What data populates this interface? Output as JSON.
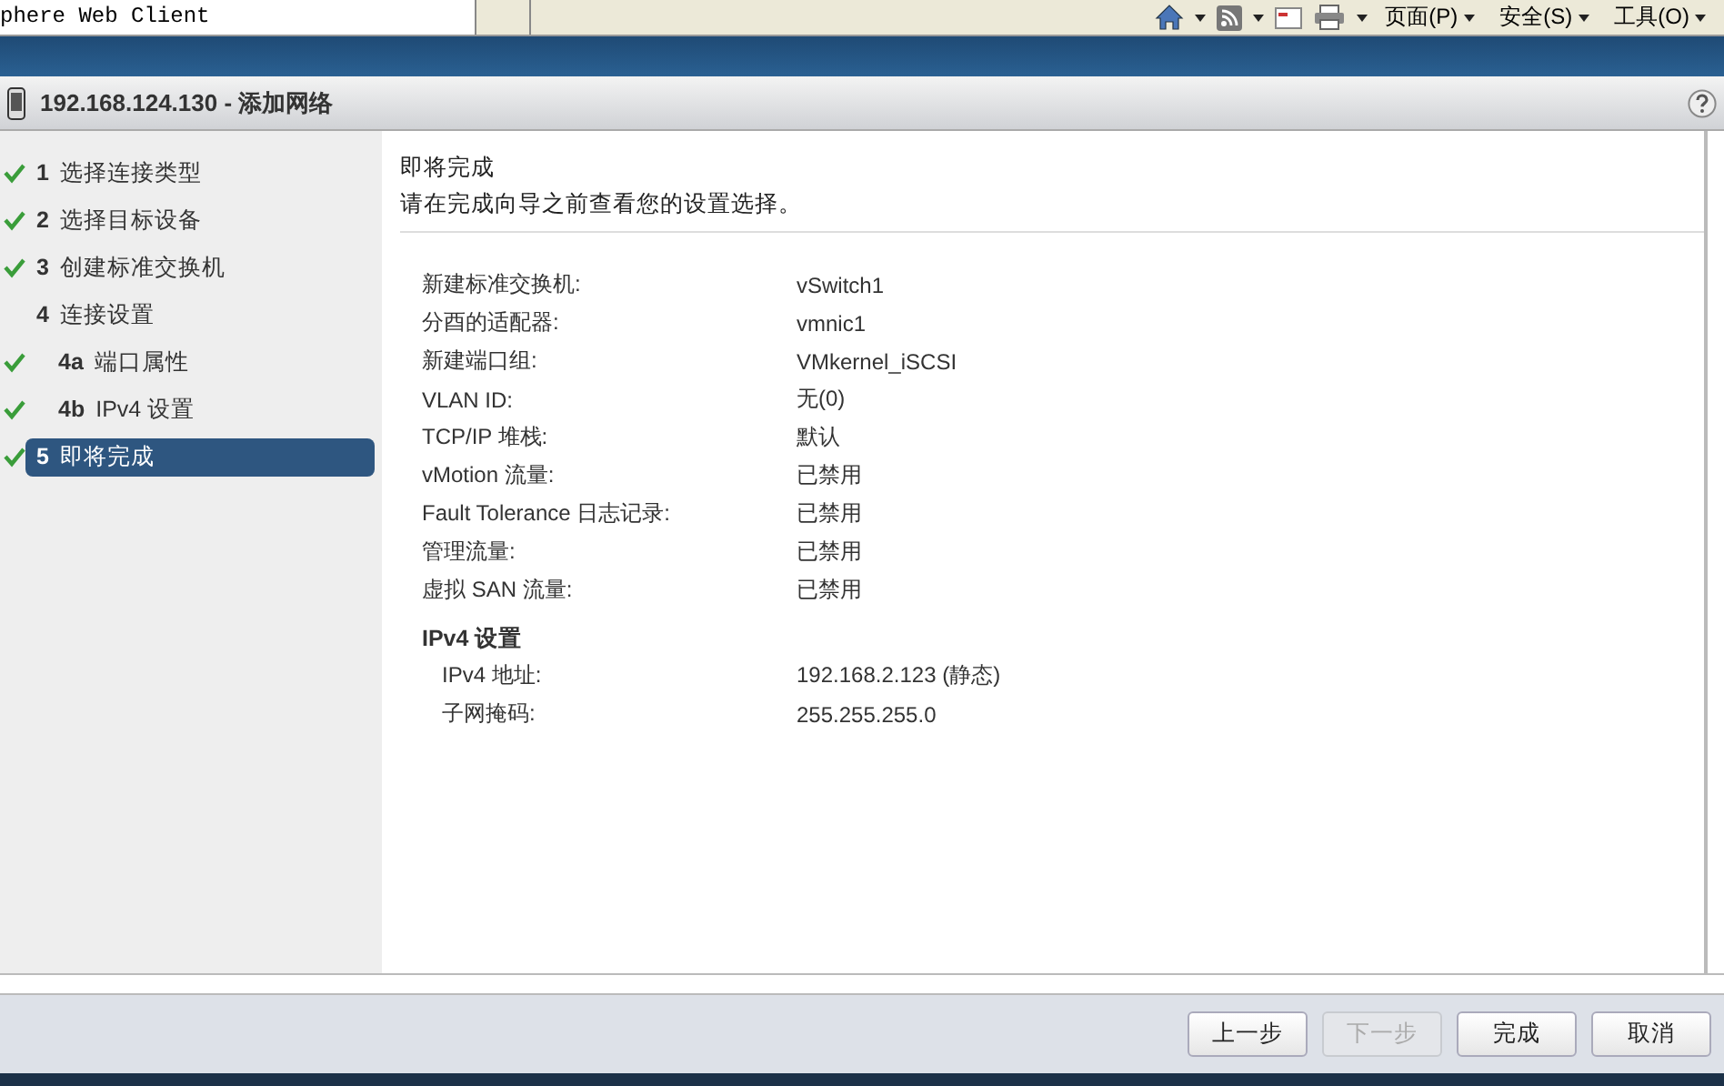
{
  "browser_tab": {
    "title": "phere Web Client"
  },
  "browser_menus": [
    {
      "label": "页面(P)"
    },
    {
      "label": "安全(S)"
    },
    {
      "label": "工具(O)"
    }
  ],
  "dialog": {
    "title": "192.168.124.130 - 添加网络"
  },
  "steps": [
    {
      "number": "1",
      "label": "选择连接类型",
      "done": true,
      "selected": false
    },
    {
      "number": "2",
      "label": "选择目标设备",
      "done": true,
      "selected": false
    },
    {
      "number": "3",
      "label": "创建标准交换机",
      "done": true,
      "selected": false
    },
    {
      "number": "4",
      "label": "连接设置",
      "done": false,
      "selected": false,
      "children": [
        {
          "number": "4a",
          "label": "端口属性",
          "done": true,
          "selected": false
        },
        {
          "number": "4b",
          "label": "IPv4 设置",
          "done": true,
          "selected": false
        }
      ]
    },
    {
      "number": "5",
      "label": "即将完成",
      "done": true,
      "selected": true
    }
  ],
  "page": {
    "heading": "即将完成",
    "description": "请在完成向导之前查看您的设置选择。"
  },
  "summary": [
    {
      "label": "新建标准交换机:",
      "value": "vSwitch1"
    },
    {
      "label": "分酉的适配器:",
      "value": "vmnic1"
    },
    {
      "label": "新建端口组:",
      "value": "VMkernel_iSCSI"
    },
    {
      "label": "VLAN ID:",
      "value": "无(0)"
    },
    {
      "label": "TCP/IP 堆栈:",
      "value": "默认"
    },
    {
      "label": "vMotion 流量:",
      "value": "已禁用"
    },
    {
      "label": "Fault Tolerance 日志记录:",
      "value": "已禁用"
    },
    {
      "label": "管理流量:",
      "value": "已禁用"
    },
    {
      "label": "虚拟 SAN 流量:",
      "value": "已禁用"
    }
  ],
  "ipv4": {
    "heading": "IPv4 设置",
    "rows": [
      {
        "label": "IPv4 地址:",
        "value": "192.168.2.123 (静态)"
      },
      {
        "label": "子网掩码:",
        "value": "255.255.255.0"
      }
    ]
  },
  "buttons": [
    {
      "label": "上一步",
      "disabled": false
    },
    {
      "label": "下一步",
      "disabled": true
    },
    {
      "label": "完成",
      "disabled": false
    },
    {
      "label": "取消",
      "disabled": false
    }
  ]
}
